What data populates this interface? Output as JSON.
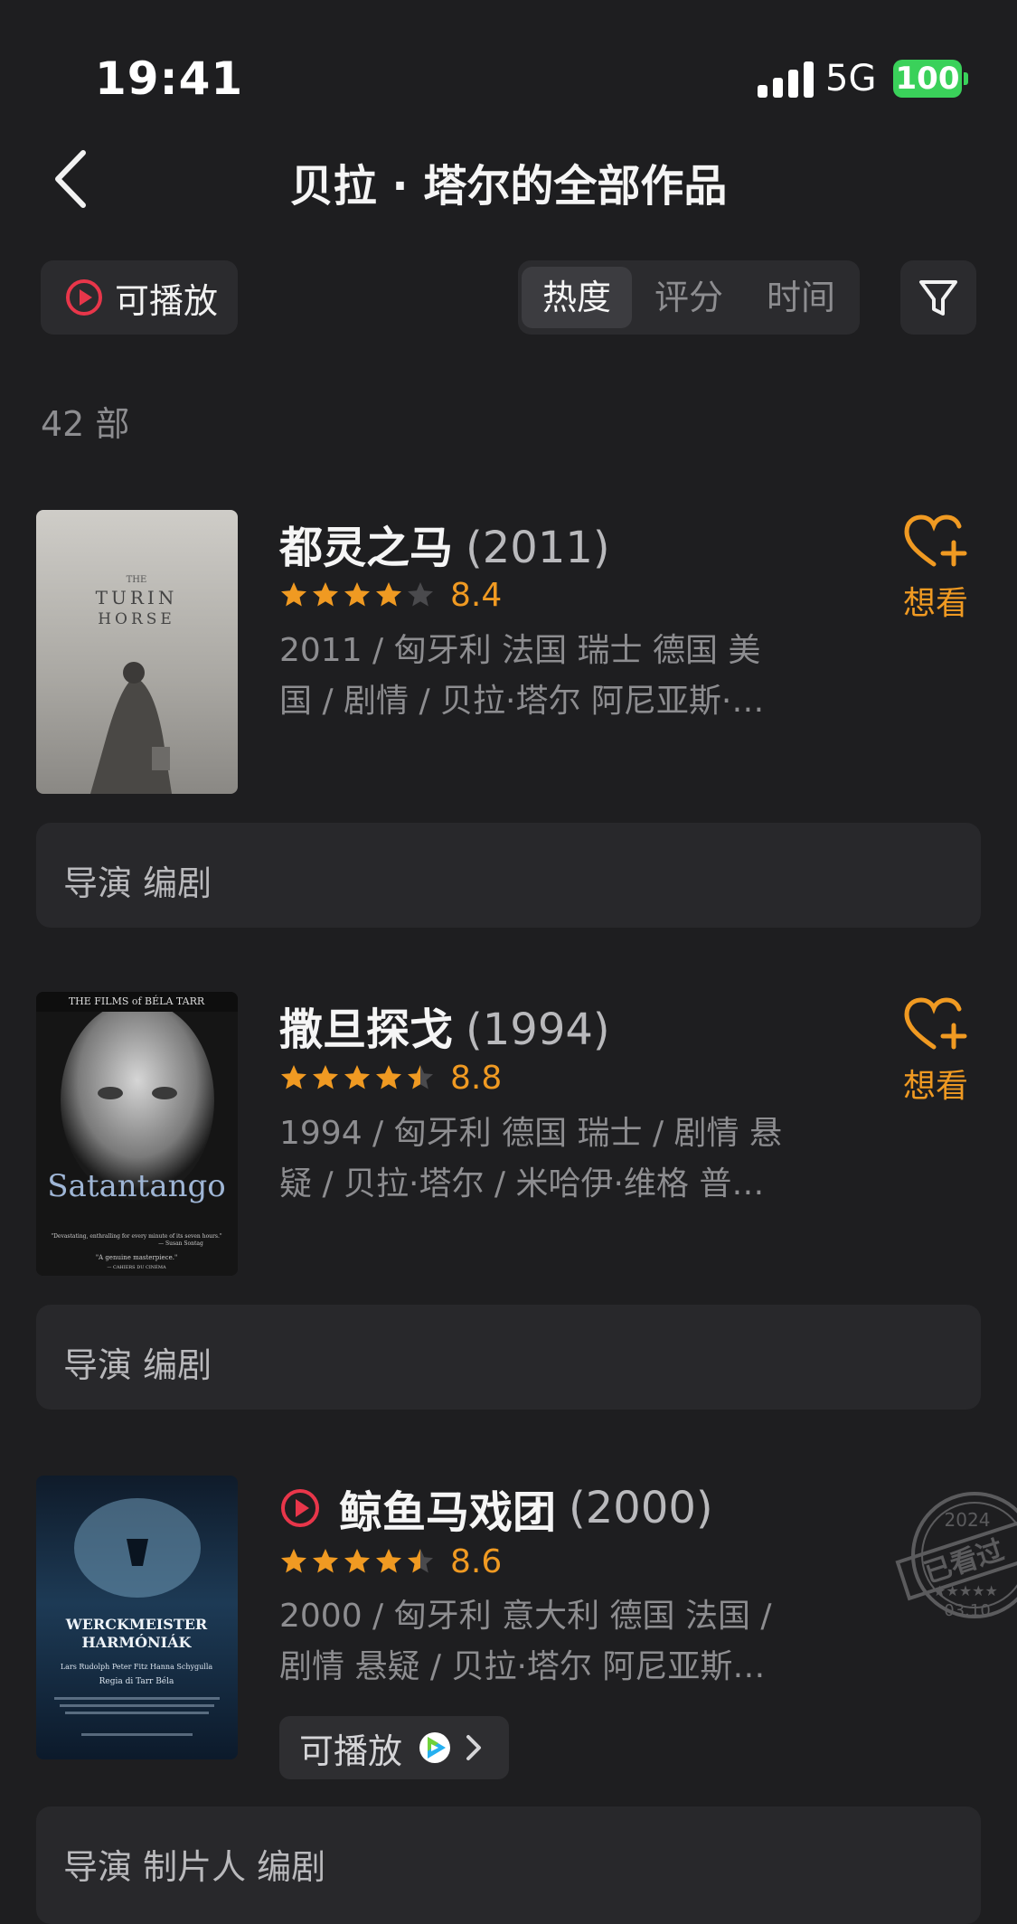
{
  "status_bar": {
    "time": "19:41",
    "network": "5G",
    "battery": "100"
  },
  "nav": {
    "title": "贝拉 · 塔尔的全部作品"
  },
  "toolbar": {
    "playable_label": "可播放",
    "sort_options": [
      "热度",
      "评分",
      "时间"
    ],
    "active_sort": "热度"
  },
  "count_label": "42 部",
  "films": [
    {
      "title": "都灵之马",
      "year": "(2011)",
      "rating": "8.4",
      "stars": 4,
      "meta_line1": "2011 / 匈牙利 法国 瑞士 德国 美",
      "meta_line2": "国 / 剧情 / 贝拉·塔尔 阿尼亚斯·…",
      "roles": "导演 编剧",
      "want_label": "想看",
      "poster_text": [
        "THE",
        "TURIN",
        "HORSE"
      ]
    },
    {
      "title": "撒旦探戈",
      "year": "(1994)",
      "rating": "8.8",
      "stars": 4.5,
      "meta_line1": "1994 / 匈牙利 德国 瑞士 / 剧情 悬",
      "meta_line2": "疑 / 贝拉·塔尔 / 米哈伊·维格 普…",
      "roles": "导演 编剧",
      "want_label": "想看",
      "poster_text": [
        "THE FILMS of BÉLA TARR",
        "Satantango",
        "\"Devastating, enthralling for every minute of its seven hours.\"",
        "— Susan Sontag",
        "\"A genuine masterpiece.\"",
        "— CAHIERS DU CINÉMA"
      ]
    },
    {
      "title": "鲸鱼马戏团",
      "year": "(2000)",
      "rating": "8.6",
      "stars": 4.5,
      "meta_line1": "2000 / 匈牙利 意大利 德国 法国 /",
      "meta_line2": "剧情 悬疑 / 贝拉·塔尔 阿尼亚斯…",
      "roles": "导演 制片人 编剧",
      "playable_label": "可播放",
      "stamp": {
        "year": "2024",
        "text": "已看过",
        "date": "03.10"
      },
      "poster_text": [
        "WERCKMEISTER",
        "HARMÓNIÁK",
        "Lars Rudolph   Peter Fitz   Hanna Schygulla",
        "Regia di Tarr Béla"
      ]
    }
  ],
  "colors": {
    "background": "#1e1e20",
    "accent": "#f09a22",
    "play_red": "#e8364a",
    "card": "#28282b"
  }
}
